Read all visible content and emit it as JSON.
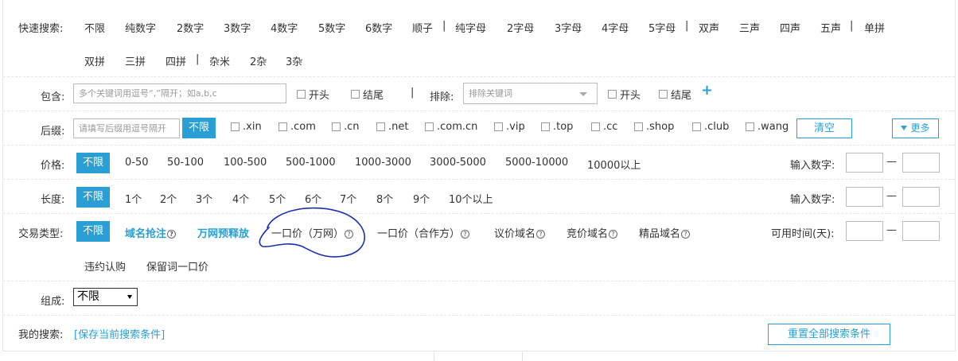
{
  "quick": {
    "label": "快速搜索:",
    "row1": [
      "不限",
      "纯数字",
      "2数字",
      "3数字",
      "4数字",
      "5数字",
      "6数字",
      "顺子",
      "纯字母",
      "2字母",
      "3字母",
      "4字母",
      "5字母",
      "双声",
      "三声",
      "四声",
      "五声",
      "单拼"
    ],
    "row2": [
      "双拼",
      "三拼",
      "四拼",
      "杂米",
      "2杂",
      "3杂"
    ],
    "sep": "|"
  },
  "include": {
    "label": "包含:",
    "placeholder": "多个关键词用逗号“,”隔开；如a,b,c",
    "start": "开头",
    "end": "结尾",
    "exclude_label": "排除:",
    "exclude_placeholder": "排除关键词",
    "ex_start": "开头",
    "ex_end": "结尾",
    "plus": "+"
  },
  "suffix": {
    "label": "后缀:",
    "placeholder": "请填写后缀用逗号隔开",
    "selected": "不限",
    "options": [
      ".xin",
      ".com",
      ".cn",
      ".net",
      ".com.cn",
      ".vip",
      ".top",
      ".cc",
      ".shop",
      ".club",
      ".wang"
    ],
    "clear": "清空",
    "more": "更多"
  },
  "price": {
    "label": "价格:",
    "selected": "不限",
    "options": [
      "0-50",
      "50-100",
      "100-500",
      "500-1000",
      "1000-3000",
      "3000-5000",
      "5000-10000",
      "10000以上"
    ],
    "input_label": "输入数字:",
    "dash": "—"
  },
  "length": {
    "label": "长度:",
    "selected": "不限",
    "options": [
      "1个",
      "2个",
      "3个",
      "4个",
      "5个",
      "6个",
      "7个",
      "8个",
      "9个",
      "10个以上"
    ],
    "input_label": "输入数字:",
    "dash": "—"
  },
  "trade": {
    "label": "交易类型:",
    "selected": "不限",
    "blue_opts": [
      "域名抢注",
      "万网预释放"
    ],
    "opts": [
      "一口价（万网）",
      "一口价（合作方）",
      "议价域名",
      "竞价域名",
      "精品域名"
    ],
    "row2": [
      "违约认购",
      "保留词一口价"
    ],
    "q": "?",
    "time_label": "可用时间(天):",
    "dash": "—"
  },
  "compose": {
    "label": "组成:",
    "value": "不限"
  },
  "mysearch": {
    "label": "我的搜索:",
    "save": "[保存当前搜索条件]",
    "reset": "重置全部搜索条件"
  }
}
